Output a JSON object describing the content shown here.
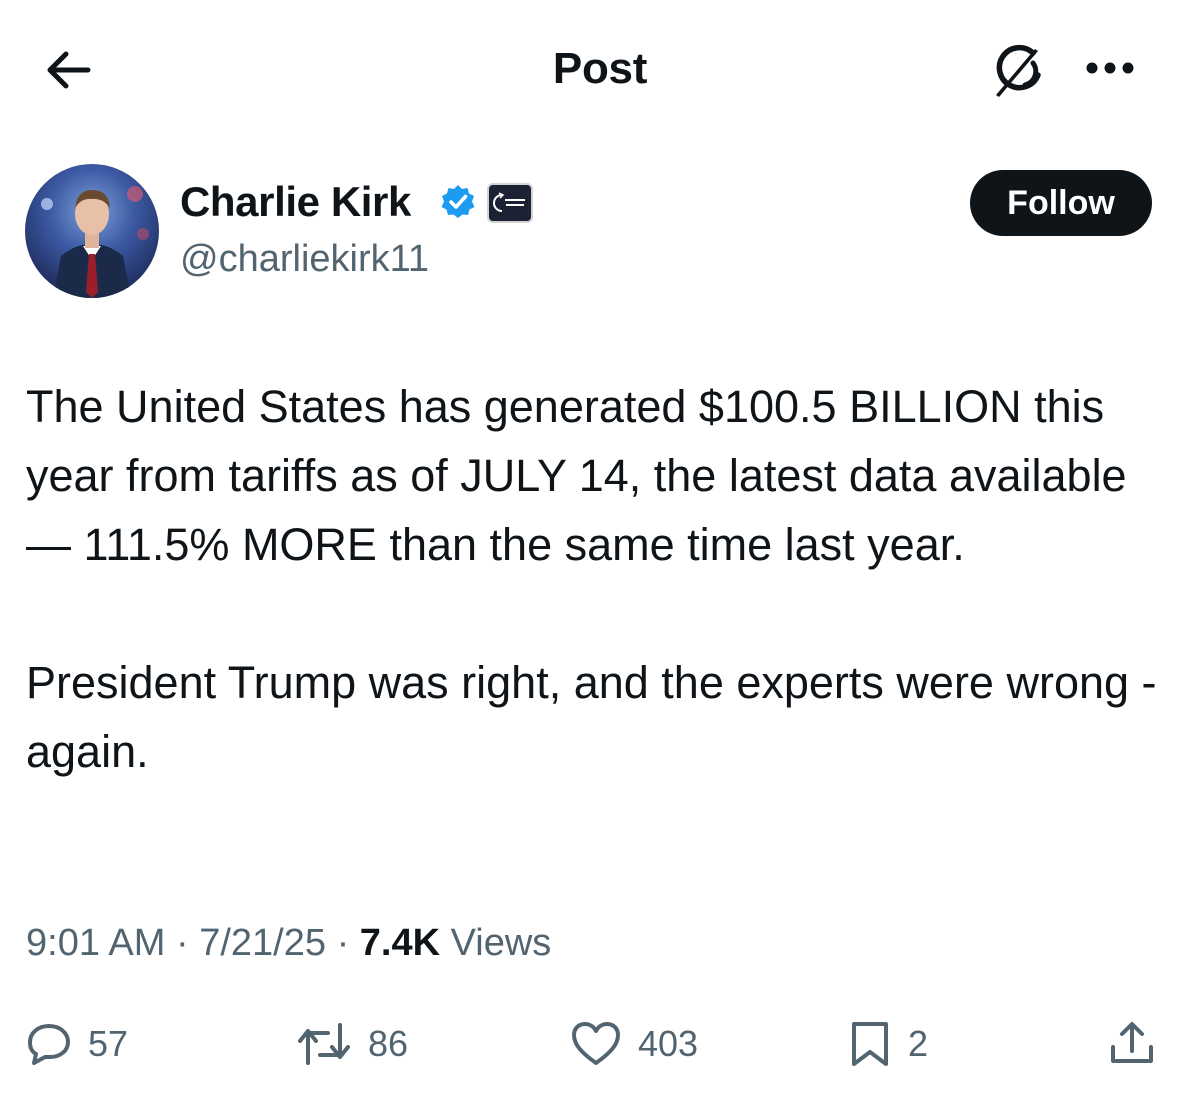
{
  "header": {
    "title": "Post",
    "back_icon": "arrow-left-icon",
    "grok_icon": "grok-icon",
    "more_icon": "more-dots-icon"
  },
  "author": {
    "name": "Charlie Kirk",
    "handle": "@charliekirk11",
    "verified": true,
    "verified_color": "#1d9bf0",
    "affiliate_badge": "Turning Point USA",
    "follow_label": "Follow"
  },
  "tweet": {
    "paragraphs": [
      "The United States has generated $100.5 BILLION this year from tariffs as of JULY 14, the latest data available — 111.5% MORE than the same time last year.",
      "President Trump was right, and the experts were wrong - again."
    ]
  },
  "meta": {
    "time": "9:01 AM",
    "separator": "·",
    "date": "7/21/25",
    "views_count": "7.4K",
    "views_label": "Views"
  },
  "actions": {
    "replies": "57",
    "reposts": "86",
    "likes": "403",
    "bookmarks": "2"
  },
  "colors": {
    "text": "#0f1419",
    "secondary": "#536471",
    "follow_bg": "#0f1419",
    "verified": "#1d9bf0"
  }
}
